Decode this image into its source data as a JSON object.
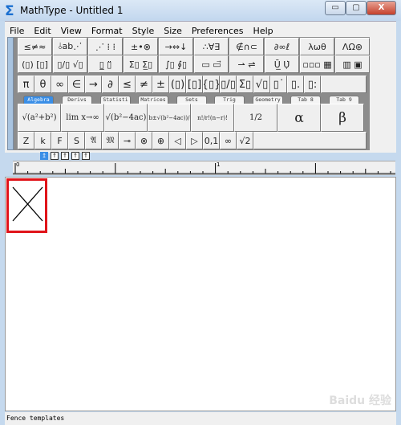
{
  "window": {
    "title": "MathType - Untitled 1",
    "minimize": "▭",
    "maximize": "▢",
    "close": "X"
  },
  "menu": [
    "File",
    "Edit",
    "View",
    "Format",
    "Style",
    "Size",
    "Preferences",
    "Help"
  ],
  "palette_row1": [
    "≤≠≈",
    "⫰ab⋰",
    "⋰ ⁞ ⁞",
    "±•⊗",
    "→⇔↓",
    "∴∀∃",
    "∉∩⊂",
    "∂∞ℓ",
    "λωθ",
    "ΛΩ⊛"
  ],
  "palette_row2": [
    "(▯) [▯]",
    "▯/▯ √▯",
    "▯̲ ▯̈",
    "Σ▯ Σ̲▯",
    "∫▯ ∮▯",
    "▭ ▭⃗",
    "⇀ ⇌",
    "Ū̲ Ụ̇",
    "▫▫▫ ▦",
    "▥ ▣"
  ],
  "symbols_row": [
    "π",
    "θ",
    "∞",
    "∈",
    "→",
    "∂",
    "≤",
    "≠",
    "±",
    "(▯)",
    "[▯]",
    "{▯}",
    "▯/▯",
    "Σ▯",
    "√▯",
    "▯˙",
    "▯.",
    "▯:"
  ],
  "tabs": [
    "Algebra",
    "Derivs",
    "Statisti",
    "Matrices",
    "Sets",
    "Trig",
    "Geometry",
    "Tab 8",
    "Tab 9"
  ],
  "active_tab": "Algebra",
  "templates": [
    "√(a²+b²)",
    "lim x→∞",
    "√(b²−4ac)",
    "(−b±√(b²−4ac))/2a",
    "n!/r!(n−r)!",
    "1/2",
    "α",
    "β"
  ],
  "small_row": [
    "Z",
    "k",
    "F",
    "S",
    "𝔄",
    "𝔐",
    "⊸",
    "⊗",
    "⊕",
    "◁",
    "▷",
    "[0,1]",
    "∞",
    "√2"
  ],
  "size_buttons": [
    "↥",
    "↑",
    "↑",
    "↑",
    "↑"
  ],
  "ruler": {
    "labels": [
      "0",
      "1"
    ]
  },
  "status": "Fence templates",
  "watermark": "Baidu 经验",
  "accent": "#3a8ee6",
  "highlight": "#e0141a"
}
